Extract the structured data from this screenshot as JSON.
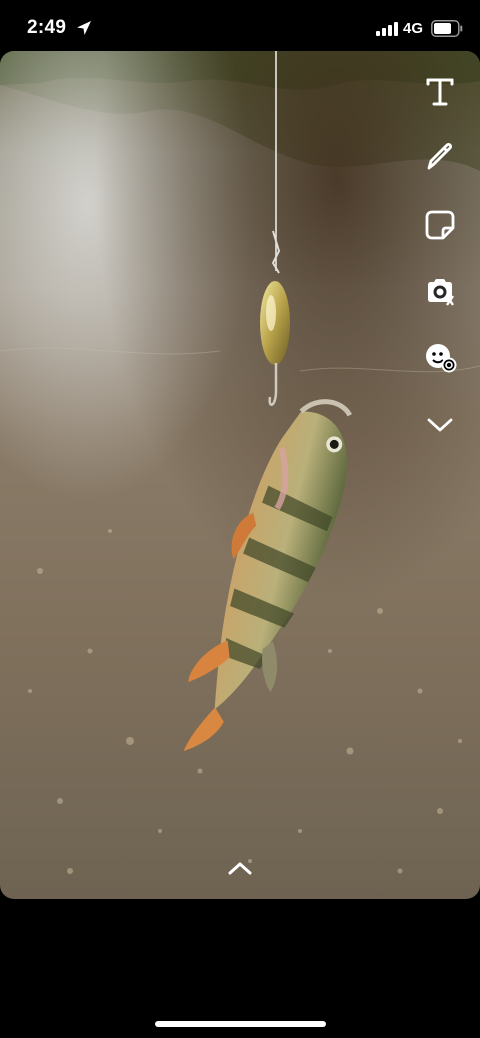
{
  "status_bar": {
    "time": "2:49",
    "network": "4G",
    "location_icon": "location-arrow-icon",
    "signal_icon": "cellular-signal-icon",
    "battery_icon": "battery-icon"
  },
  "photo": {
    "subject": "fish-on-lure-photo"
  },
  "toolbar": {
    "items": [
      {
        "icon": "text-tool-icon"
      },
      {
        "icon": "pencil-icon"
      },
      {
        "icon": "sticker-icon"
      },
      {
        "icon": "scissors-camera-icon"
      },
      {
        "icon": "lens-icon"
      },
      {
        "icon": "chevron-down-icon"
      }
    ]
  },
  "bottom": {
    "swipe_icon": "chevron-up-icon"
  },
  "colors": {
    "background": "#000000",
    "icon": "#ffffff"
  }
}
